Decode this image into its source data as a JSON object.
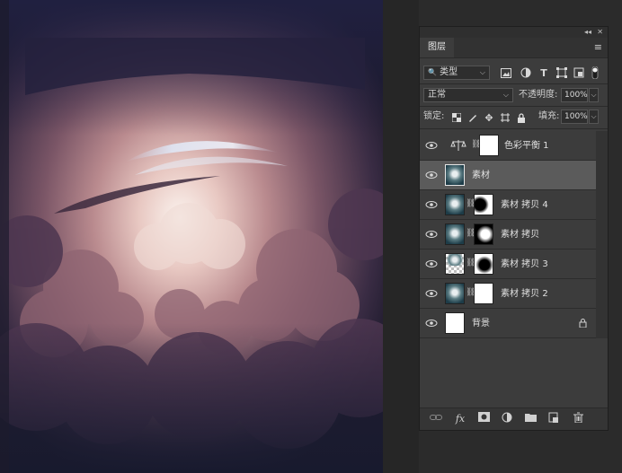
{
  "panel": {
    "collapse_icon": "◂◂",
    "close_icon": "✕",
    "tab_label": "图层",
    "menu_icon": "≡",
    "filter": {
      "kind_label": "类型",
      "icons": [
        "image-filter-icon",
        "adjustment-filter-icon",
        "text-filter-icon",
        "shape-filter-icon",
        "smartobject-filter-icon",
        "filter-toggle-icon"
      ]
    },
    "blend_mode": "正常",
    "opacity_label": "不透明度:",
    "opacity_value": "100%",
    "lock_label": "锁定:",
    "fill_label": "填充:",
    "fill_value": "100%"
  },
  "layers": [
    {
      "name": "色彩平衡 1",
      "kind": "adjustment",
      "selected": false,
      "has_mask": true
    },
    {
      "name": "素材",
      "kind": "image",
      "selected": true,
      "has_mask": false
    },
    {
      "name": "素材 拷贝 4",
      "kind": "image",
      "selected": false,
      "has_mask": true
    },
    {
      "name": "素材 拷贝",
      "kind": "image",
      "selected": false,
      "has_mask": true
    },
    {
      "name": "素材 拷贝 3",
      "kind": "image",
      "selected": false,
      "has_mask": true
    },
    {
      "name": "素材 拷贝 2",
      "kind": "image",
      "selected": false,
      "has_mask": true
    },
    {
      "name": "背景",
      "kind": "background",
      "selected": false,
      "has_mask": false,
      "locked": true
    }
  ],
  "bottom_icons": [
    "link-icon",
    "fx-icon",
    "add-mask-icon",
    "adjustment-icon",
    "group-folder-icon",
    "new-layer-icon",
    "trash-icon"
  ],
  "glyphs": {
    "eye": "👁",
    "chain": "⛓",
    "lock": "🔒",
    "kind_icon": "🔍"
  },
  "colors": {
    "panel_bg": "#3c3c3c",
    "selected_row": "#5b5b5b",
    "canvas_sky": "#2a2440"
  }
}
